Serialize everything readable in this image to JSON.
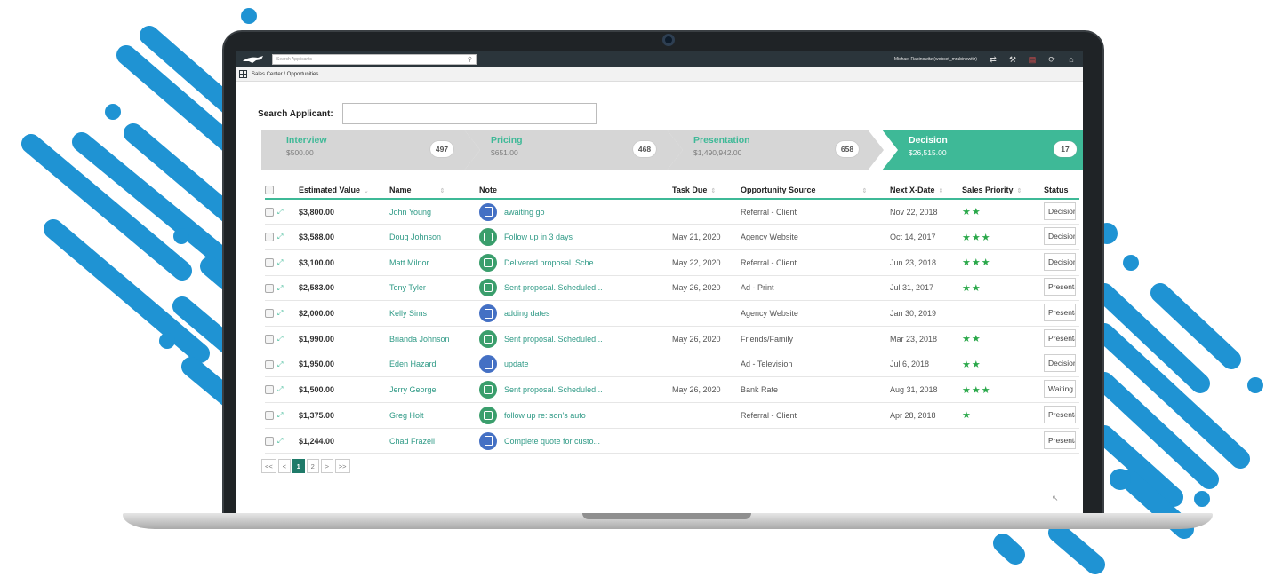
{
  "topbar": {
    "search_placeholder": "Search Applicants",
    "user": "Michael Rabinowitz (webcet_mrabinowitz) ·",
    "icons": [
      "swap-icon",
      "tools-icon",
      "notifications-icon",
      "sync-icon",
      "home-icon"
    ]
  },
  "breadcrumb": "Sales Center / Opportunities",
  "search_applicant": {
    "label": "Search Applicant:",
    "value": ""
  },
  "stages": [
    {
      "name": "Interview",
      "amount": "$500.00",
      "count": "497"
    },
    {
      "name": "Pricing",
      "amount": "$651.00",
      "count": "468"
    },
    {
      "name": "Presentation",
      "amount": "$1,490,942.00",
      "count": "658"
    },
    {
      "name": "Decision",
      "amount": "$26,515.00",
      "count": "17"
    }
  ],
  "table": {
    "headers": {
      "estimated_value": "Estimated Value",
      "name": "Name",
      "note": "Note",
      "task_due": "Task Due",
      "source": "Opportunity Source",
      "next_date": "Next X-Date",
      "priority": "Sales Priority",
      "status": "Status"
    },
    "rows": [
      {
        "value": "$3,800.00",
        "name": "John Young",
        "note_icon": "blue",
        "note": "awaiting go",
        "task_due": "",
        "source": "Referral - Client",
        "next_date": "Nov 22, 2018",
        "stars": "★★",
        "status": "Decision"
      },
      {
        "value": "$3,588.00",
        "name": "Doug Johnson",
        "note_icon": "green",
        "note": "Follow up in 3 days",
        "task_due": "May 21, 2020",
        "source": "Agency Website",
        "next_date": "Oct 14, 2017",
        "stars": "★★★",
        "status": "Decision"
      },
      {
        "value": "$3,100.00",
        "name": "Matt Milnor",
        "note_icon": "green",
        "note": "Delivered proposal. Sche...",
        "task_due": "May 22, 2020",
        "source": "Referral - Client",
        "next_date": "Jun 23, 2018",
        "stars": "★★★",
        "status": "Decision"
      },
      {
        "value": "$2,583.00",
        "name": "Tony Tyler",
        "note_icon": "green",
        "note": "Sent proposal. Scheduled...",
        "task_due": "May 26, 2020",
        "source": "Ad - Print",
        "next_date": "Jul 31, 2017",
        "stars": "★★",
        "status": "Presentation"
      },
      {
        "value": "$2,000.00",
        "name": "Kelly Sims",
        "note_icon": "blue",
        "note": "adding dates",
        "task_due": "",
        "source": "Agency Website",
        "next_date": "Jan 30, 2019",
        "stars": "",
        "status": "Presentation"
      },
      {
        "value": "$1,990.00",
        "name": "Brianda Johnson",
        "note_icon": "green",
        "note": "Sent proposal. Scheduled...",
        "task_due": "May 26, 2020",
        "source": "Friends/Family",
        "next_date": "Mar 23, 2018",
        "stars": "★★",
        "status": "Presentation"
      },
      {
        "value": "$1,950.00",
        "name": "Eden Hazard",
        "note_icon": "blue",
        "note": "update",
        "task_due": "",
        "source": "Ad - Television",
        "next_date": "Jul 6, 2018",
        "stars": "★★",
        "status": "Decision"
      },
      {
        "value": "$1,500.00",
        "name": "Jerry George",
        "note_icon": "green",
        "note": "Sent proposal. Scheduled...",
        "task_due": "May 26, 2020",
        "source": "Bank Rate",
        "next_date": "Aug 31, 2018",
        "stars": "★★★",
        "status": "Waiting"
      },
      {
        "value": "$1,375.00",
        "name": "Greg Holt",
        "note_icon": "green",
        "note": "follow up re: son's auto",
        "task_due": "",
        "source": "Referral - Client",
        "next_date": "Apr 28, 2018",
        "stars": "★",
        "status": "Presentation"
      },
      {
        "value": "$1,244.00",
        "name": "Chad Frazell",
        "note_icon": "blue",
        "note": "Complete quote for custo...",
        "task_due": "",
        "source": "",
        "next_date": "",
        "stars": "",
        "status": "Presentation"
      }
    ]
  },
  "pager": {
    "first": "<<",
    "prev": "<",
    "pages": [
      "1",
      "2"
    ],
    "current": "1",
    "next": ">",
    "last": ">>"
  },
  "colors": {
    "accent": "#3eb997",
    "stripe": "#1f93d3",
    "star": "#2aa84a"
  }
}
